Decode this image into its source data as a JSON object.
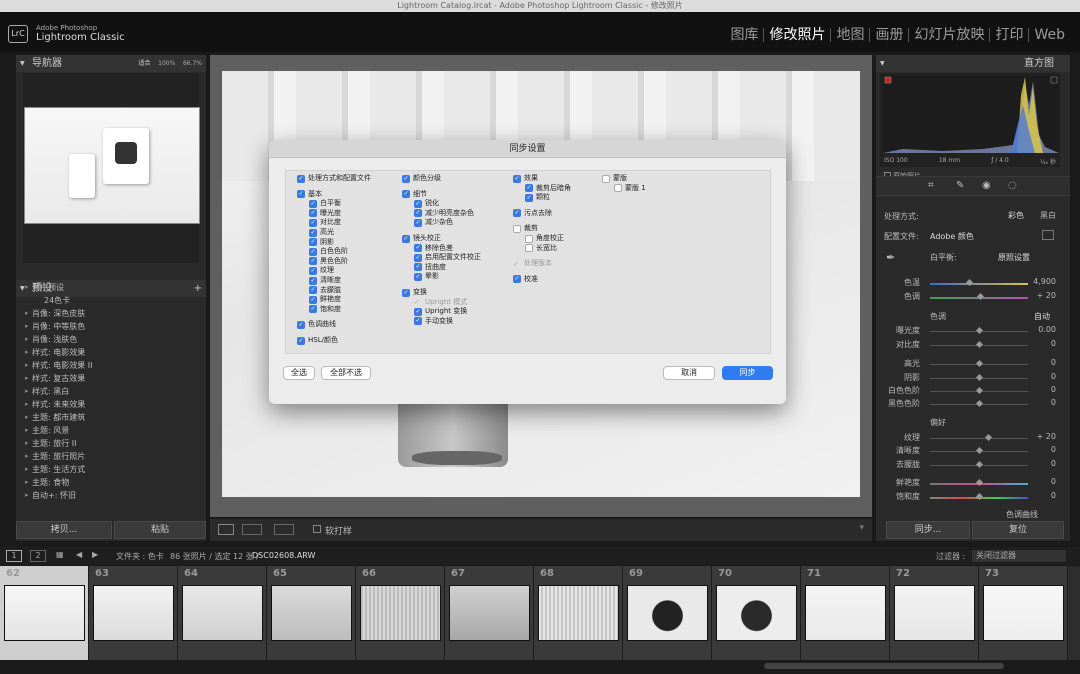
{
  "window_title": "Lightroom Catalog.lrcat - Adobe Photoshop Lightroom Classic - 修改照片",
  "app": {
    "logo": "LrC",
    "vendor": "Adobe Photoshop",
    "name": "Lightroom Classic"
  },
  "modules": [
    "图库",
    "修改照片",
    "地图",
    "画册",
    "幻灯片放映",
    "打印",
    "Web"
  ],
  "active_module": "修改照片",
  "navigator": {
    "title": "导航器",
    "zoom_fit": "适合",
    "zoom_100": "100%",
    "zoom_667": "66.7%"
  },
  "presets": {
    "title": "预设",
    "add": "+",
    "items": [
      {
        "label": "用户预设",
        "sub": false
      },
      {
        "label": "24色卡",
        "sub": true
      },
      {
        "label": "肖像: 深色皮肤",
        "sub": false
      },
      {
        "label": "肖像: 中等肤色",
        "sub": false
      },
      {
        "label": "肖像: 浅肤色",
        "sub": false
      },
      {
        "label": "样式: 电影效果",
        "sub": false
      },
      {
        "label": "样式: 电影效果 II",
        "sub": false
      },
      {
        "label": "样式: 复古效果",
        "sub": false
      },
      {
        "label": "样式: 黑白",
        "sub": false
      },
      {
        "label": "样式: 未来效果",
        "sub": false
      },
      {
        "label": "主题: 都市建筑",
        "sub": false
      },
      {
        "label": "主题: 风景",
        "sub": false
      },
      {
        "label": "主题: 旅行 II",
        "sub": false
      },
      {
        "label": "主题: 旅行照片",
        "sub": false
      },
      {
        "label": "主题: 生活方式",
        "sub": false
      },
      {
        "label": "主题: 食物",
        "sub": false
      },
      {
        "label": "自动+: 怀旧",
        "sub": false
      }
    ]
  },
  "left_buttons": {
    "copy": "拷贝...",
    "paste": "粘贴"
  },
  "toolbar": {
    "softproof": "软打样"
  },
  "dialog": {
    "title": "同步设置",
    "col1": [
      {
        "label": "处理方式和配置文件",
        "state": "on",
        "indent": 0
      },
      {
        "label": "基本",
        "state": "on",
        "indent": 0
      },
      {
        "label": "白平衡",
        "state": "on",
        "indent": 1
      },
      {
        "label": "曝光度",
        "state": "on",
        "indent": 1
      },
      {
        "label": "对比度",
        "state": "on",
        "indent": 1
      },
      {
        "label": "高光",
        "state": "on",
        "indent": 1
      },
      {
        "label": "阴影",
        "state": "on",
        "indent": 1
      },
      {
        "label": "白色色阶",
        "state": "on",
        "indent": 1
      },
      {
        "label": "黑色色阶",
        "state": "on",
        "indent": 1
      },
      {
        "label": "纹理",
        "state": "on",
        "indent": 1
      },
      {
        "label": "清晰度",
        "state": "on",
        "indent": 1
      },
      {
        "label": "去朦胧",
        "state": "on",
        "indent": 1
      },
      {
        "label": "鲜艳度",
        "state": "on",
        "indent": 1
      },
      {
        "label": "饱和度",
        "state": "on",
        "indent": 1
      },
      {
        "label": "色调曲线",
        "state": "on",
        "indent": 0
      },
      {
        "label": "HSL/颜色",
        "state": "on",
        "indent": 0
      }
    ],
    "col2": [
      {
        "label": "颜色分级",
        "state": "on",
        "indent": 0
      },
      {
        "label": "细节",
        "state": "on",
        "indent": 0
      },
      {
        "label": "锐化",
        "state": "on",
        "indent": 1
      },
      {
        "label": "减少明亮度杂色",
        "state": "on",
        "indent": 1
      },
      {
        "label": "减少杂色",
        "state": "on",
        "indent": 1
      },
      {
        "label": "镜头校正",
        "state": "on",
        "indent": 0
      },
      {
        "label": "移除色差",
        "state": "on",
        "indent": 1
      },
      {
        "label": "启用配置文件校正",
        "state": "on",
        "indent": 1
      },
      {
        "label": "扭曲度",
        "state": "on",
        "indent": 1
      },
      {
        "label": "晕影",
        "state": "on",
        "indent": 1
      },
      {
        "label": "变换",
        "state": "on",
        "indent": 0
      },
      {
        "label": "Upright 模式",
        "state": "dis",
        "indent": 1
      },
      {
        "label": "Upright 变换",
        "state": "on",
        "indent": 1
      },
      {
        "label": "手动变换",
        "state": "on",
        "indent": 1
      }
    ],
    "col3": [
      {
        "label": "效果",
        "state": "on",
        "indent": 0
      },
      {
        "label": "裁剪后暗角",
        "state": "on",
        "indent": 1
      },
      {
        "label": "颗粒",
        "state": "on",
        "indent": 1
      },
      {
        "label": "污点去除",
        "state": "on",
        "indent": 0
      },
      {
        "label": "裁剪",
        "state": "off",
        "indent": 0
      },
      {
        "label": "角度校正",
        "state": "off",
        "indent": 1
      },
      {
        "label": "长宽比",
        "state": "off",
        "indent": 1
      },
      {
        "label": "处理版本",
        "state": "dis",
        "indent": 0
      },
      {
        "label": "校准",
        "state": "on",
        "indent": 0
      }
    ],
    "col4": [
      {
        "label": "蒙版",
        "state": "off",
        "indent": 0
      },
      {
        "label": "蒙版 1",
        "state": "off",
        "indent": 1
      }
    ],
    "btn_select_all": "全选",
    "btn_select_none": "全部不选",
    "btn_cancel": "取消",
    "btn_sync": "同步"
  },
  "right": {
    "histogram_title": "直方图",
    "iso": "ISO 100",
    "focal": "18 mm",
    "aperture": "ƒ / 4.0",
    "shutter": "⅟₄₀ 秒",
    "original_photo": "原始照片",
    "treatment_label": "处理方式:",
    "treatment_color": "彩色",
    "treatment_bw": "黑白",
    "profile_label": "配置文件:",
    "profile_value": "Adobe 颜色",
    "wb_label": "白平衡:",
    "wb_value": "原照设置",
    "tone_label": "色调",
    "tone_auto": "自动",
    "presence_label": "偏好",
    "curve_label": "色调曲线",
    "sliders": [
      {
        "label": "色温",
        "value": "4,900",
        "pos": 0.4
      },
      {
        "label": "色调",
        "value": "+ 20",
        "pos": 0.52
      },
      {
        "label": "曝光度",
        "value": "0.00",
        "pos": 0.5
      },
      {
        "label": "对比度",
        "value": "0",
        "pos": 0.5
      },
      {
        "label": "高光",
        "value": "0",
        "pos": 0.5
      },
      {
        "label": "阴影",
        "value": "0",
        "pos": 0.5
      },
      {
        "label": "白色色阶",
        "value": "0",
        "pos": 0.5
      },
      {
        "label": "黑色色阶",
        "value": "0",
        "pos": 0.5
      },
      {
        "label": "纹理",
        "value": "+ 20",
        "pos": 0.6
      },
      {
        "label": "清晰度",
        "value": "0",
        "pos": 0.5
      },
      {
        "label": "去朦胧",
        "value": "0",
        "pos": 0.5
      },
      {
        "label": "鲜艳度",
        "value": "0",
        "pos": 0.5
      },
      {
        "label": "饱和度",
        "value": "0",
        "pos": 0.5
      }
    ],
    "btn_sync": "同步...",
    "btn_reset": "复位"
  },
  "filmstrip": {
    "page1": "1",
    "page2": "2",
    "source": "文件夹 : 色卡",
    "count": "86 张照片 / 选定 12 张 /",
    "file": "DSC02608.ARW",
    "filter_label": "过滤器 :",
    "filter_value": "关闭过滤器",
    "numbers": [
      "62",
      "63",
      "64",
      "65",
      "66",
      "67",
      "68",
      "69",
      "70",
      "71",
      "72",
      "73"
    ]
  }
}
